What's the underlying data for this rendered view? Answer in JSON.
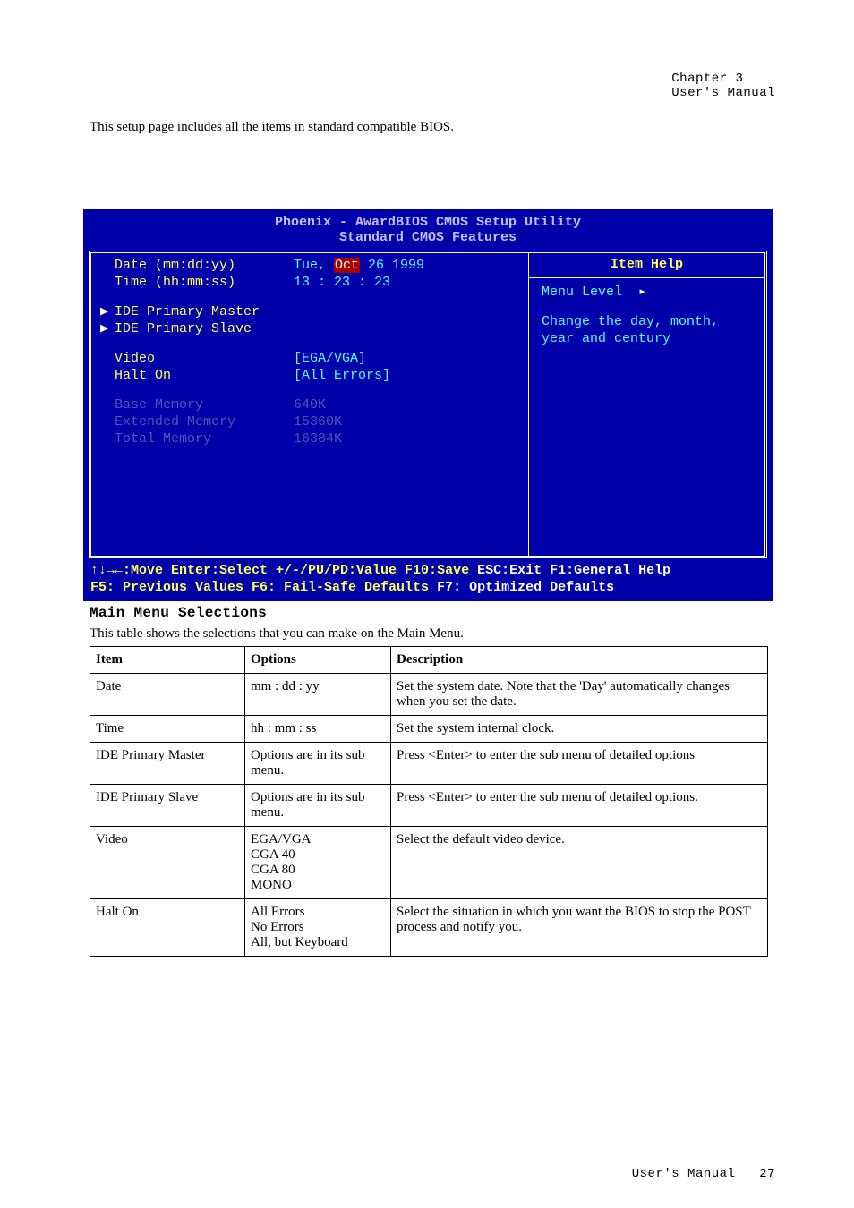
{
  "header": {
    "chapter": "Chapter 3",
    "manual": "User's Manual"
  },
  "intro_text": "This setup page includes all the items in standard compatible BIOS.",
  "bios": {
    "title_line1": "Phoenix - AwardBIOS CMOS Setup Utility",
    "title_line2": "Standard CMOS Features",
    "rows": {
      "date_label": "Date (mm:dd:yy)",
      "date_value_prefix": "Tue, ",
      "date_value_sel": "Oct",
      "date_value_suffix": " 26 1999",
      "time_label": "Time (hh:mm:ss)",
      "time_value": "13 : 23 : 23",
      "ide_pm": "IDE Primary Master",
      "ide_ps": "IDE Primary Slave",
      "video_label": "Video",
      "video_value": "[EGA/VGA]",
      "halt_label": "Halt On",
      "halt_value": "[All Errors]",
      "base_label": "Base Memory",
      "base_value": "640K",
      "ext_label": "Extended Memory",
      "ext_value": "15360K",
      "tot_label": "Total Memory",
      "tot_value": "16384K"
    },
    "help": {
      "title": "Item Help",
      "menu_level": "Menu Level",
      "tri": "▸",
      "line1": "Change the day, month,",
      "line2": "year and century"
    },
    "foot": {
      "l1a": "↑↓→←:Move  Enter:Select  +/-/PU/PD:Value  F10:Save  ",
      "l1b": "ESC:Exit  F1:General Help",
      "l2a": "  F5: Previous Values   F6: Fail-Safe Defaults   ",
      "l2b": "F7: Optimized Defaults"
    }
  },
  "section_title": "Main Menu Selections",
  "table_text": "This table shows the selections that you can make on the Main Menu.",
  "table": {
    "head": {
      "c1": "Item",
      "c2": "Options",
      "c3": "Description"
    },
    "rows": [
      {
        "c1": "Date",
        "c2": "mm : dd : yy",
        "c3": "Set the system date.  Note that the 'Day' automatically changes when you set the date."
      },
      {
        "c1": "Time",
        "c2": "hh : mm : ss",
        "c3": "Set the system internal clock."
      },
      {
        "c1": "IDE Primary Master",
        "c2": "Options are in its sub menu.",
        "c3": "Press <Enter> to enter the sub menu of detailed options"
      },
      {
        "c1": "IDE Primary Slave",
        "c2": "Options are in its sub menu.",
        "c3": "Press <Enter> to enter the sub menu of detailed options."
      },
      {
        "c1": "Video",
        "c2": "EGA/VGA\nCGA 40\nCGA 80\nMONO",
        "c3": "Select the default video device."
      },
      {
        "c1": "Halt On",
        "c2": "All Errors\nNo Errors\nAll, but Keyboard",
        "c3": "Select the situation in which you want the BIOS to stop the POST process and notify you."
      }
    ]
  },
  "footer": {
    "manual": "User's Manual",
    "page": "27"
  }
}
